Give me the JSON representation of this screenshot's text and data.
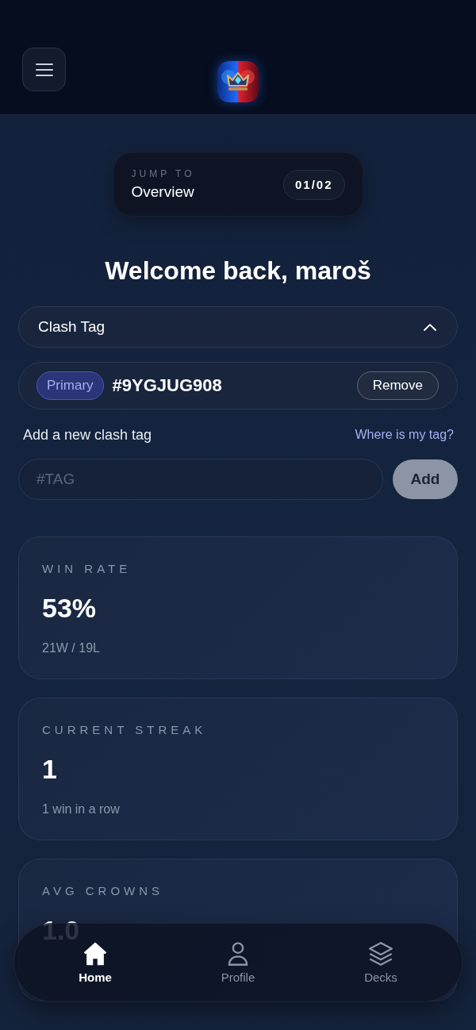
{
  "jump_to": {
    "caption": "JUMP TO",
    "section": "Overview",
    "counter": "01/02"
  },
  "welcome": "Welcome back, maroš",
  "clash_tag": {
    "title": "Clash Tag",
    "expanded": true,
    "tags": [
      {
        "badge": "Primary",
        "tag": "#9YGJUG908",
        "action": "Remove"
      }
    ],
    "add_label": "Add a new clash tag",
    "help_link": "Where is my tag?",
    "input": {
      "placeholder": "#TAG"
    },
    "add_button": {
      "label": "Add",
      "disabled": true
    }
  },
  "stats": [
    {
      "label": "WIN RATE",
      "value": "53%",
      "detail": "21W / 19L"
    },
    {
      "label": "CURRENT STREAK",
      "value": "1",
      "detail": "1 win in a row"
    },
    {
      "label": "AVG CROWNS",
      "value": "1.0"
    }
  ],
  "nav": [
    {
      "label": "Home",
      "kind": "home",
      "selected": true
    },
    {
      "label": "Profile",
      "kind": "profile",
      "selected": false
    },
    {
      "label": "Decks",
      "kind": "decks",
      "selected": false
    }
  ]
}
